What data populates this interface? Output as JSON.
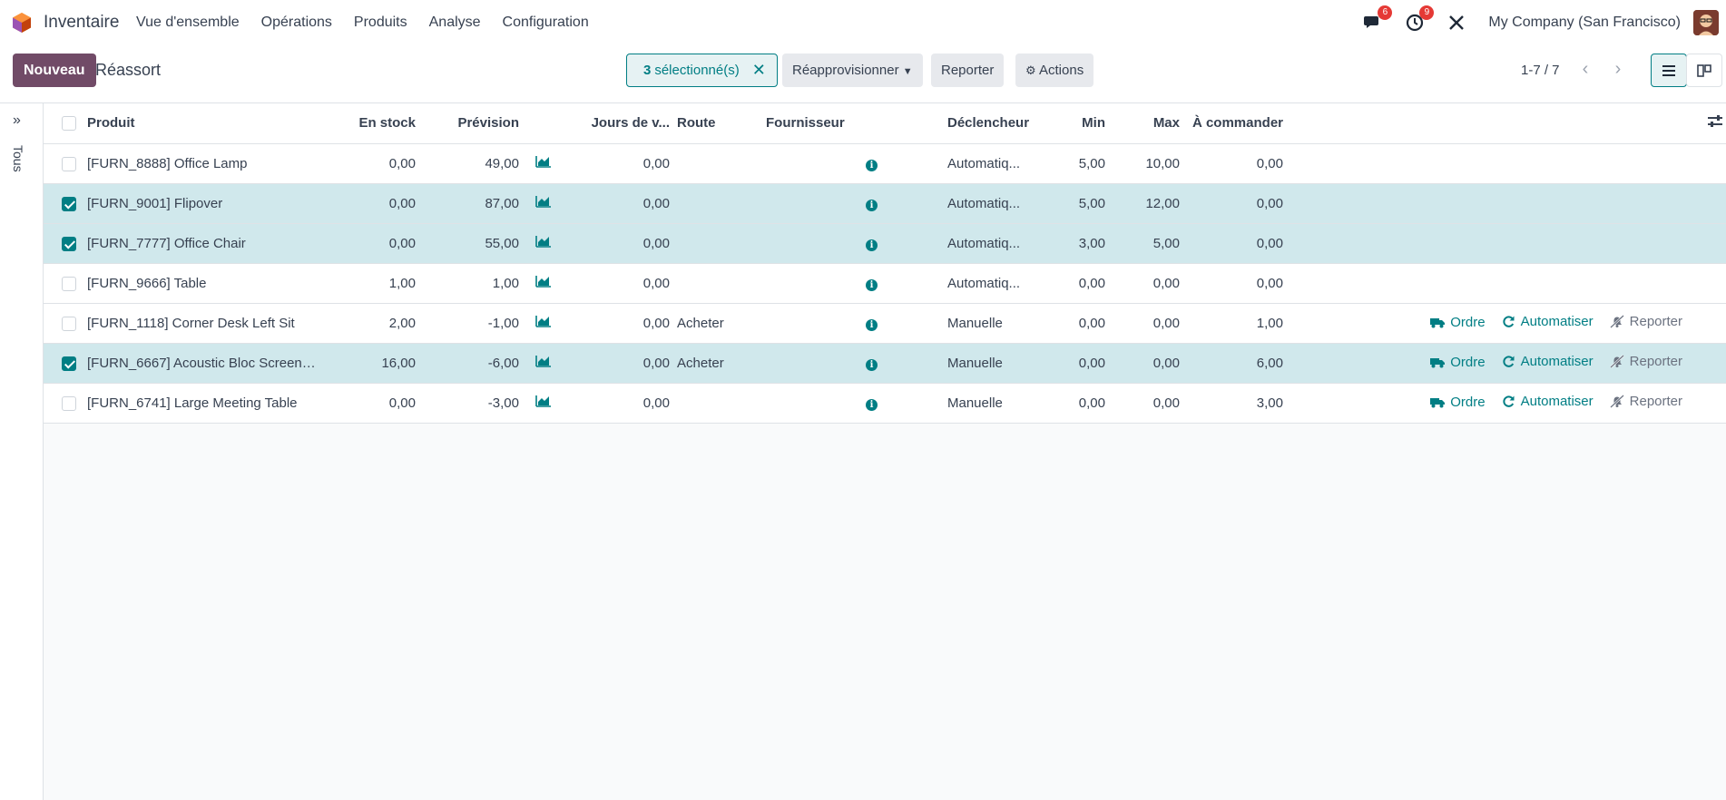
{
  "navbar": {
    "app_name": "Inventaire",
    "menu": [
      "Vue d'ensemble",
      "Opérations",
      "Produits",
      "Analyse",
      "Configuration"
    ],
    "messages_count": "6",
    "activities_count": "9",
    "company": "My Company (San Francisco)"
  },
  "control": {
    "new_label": "Nouveau",
    "title": "Réassort",
    "selected_count": "3",
    "selected_label": "sélectionné(s)",
    "replenish_label": "Réapprovisionner",
    "snooze_label": "Reporter",
    "actions_label": "Actions",
    "pager": "1-7 / 7"
  },
  "side": {
    "tous": "Tous"
  },
  "columns": {
    "product": "Produit",
    "on_hand": "En stock",
    "forecast": "Prévision",
    "days": "Jours de v...",
    "route": "Route",
    "vendor": "Fournisseur",
    "trigger": "Déclencheur",
    "min": "Min",
    "max": "Max",
    "to_order": "À commander"
  },
  "rows": [
    {
      "product": "[FURN_8888] Office Lamp",
      "on_hand": "0,00",
      "forecast": "49,00",
      "days": "0,00",
      "route": "",
      "trigger": "Automatiq...",
      "min": "5,00",
      "max": "10,00",
      "to_order": "0,00",
      "selected": false,
      "actions": false
    },
    {
      "product": "[FURN_9001] Flipover",
      "on_hand": "0,00",
      "forecast": "87,00",
      "days": "0,00",
      "route": "",
      "trigger": "Automatiq...",
      "min": "5,00",
      "max": "12,00",
      "to_order": "0,00",
      "selected": true,
      "actions": false
    },
    {
      "product": "[FURN_7777] Office Chair",
      "on_hand": "0,00",
      "forecast": "55,00",
      "days": "0,00",
      "route": "",
      "trigger": "Automatiq...",
      "min": "3,00",
      "max": "5,00",
      "to_order": "0,00",
      "selected": true,
      "actions": false
    },
    {
      "product": "[FURN_9666] Table",
      "on_hand": "1,00",
      "forecast": "1,00",
      "days": "0,00",
      "route": "",
      "trigger": "Automatiq...",
      "min": "0,00",
      "max": "0,00",
      "to_order": "0,00",
      "selected": false,
      "actions": false
    },
    {
      "product": "[FURN_1118] Corner Desk Left Sit",
      "on_hand": "2,00",
      "forecast": "-1,00",
      "days": "0,00",
      "route": "Acheter",
      "trigger": "Manuelle",
      "min": "0,00",
      "max": "0,00",
      "to_order": "1,00",
      "selected": false,
      "actions": true
    },
    {
      "product": "[FURN_6667] Acoustic Bloc Screens ...",
      "on_hand": "16,00",
      "forecast": "-6,00",
      "days": "0,00",
      "route": "Acheter",
      "trigger": "Manuelle",
      "min": "0,00",
      "max": "0,00",
      "to_order": "6,00",
      "selected": true,
      "actions": true
    },
    {
      "product": "[FURN_6741] Large Meeting Table",
      "on_hand": "0,00",
      "forecast": "-3,00",
      "days": "0,00",
      "route": "",
      "trigger": "Manuelle",
      "min": "0,00",
      "max": "0,00",
      "to_order": "3,00",
      "selected": false,
      "actions": true
    }
  ],
  "row_actions": {
    "order": "Ordre",
    "automate": "Automatiser",
    "snooze": "Reporter"
  },
  "colors": {
    "brand": "#714b67",
    "accent": "#017e84",
    "selected_row": "#d0e8ec"
  }
}
